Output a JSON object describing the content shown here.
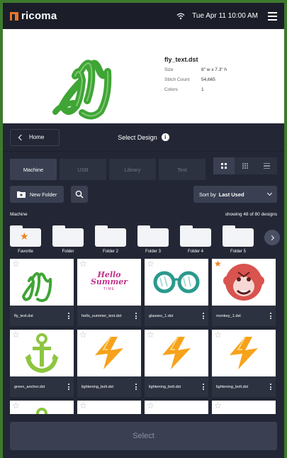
{
  "app": {
    "brand": "ricoma",
    "status_time": "Tue Apr 11  10:00 AM",
    "colors": {
      "accent": "#f0821e",
      "embroidery_green": "#3fa535",
      "bg": "#232735"
    }
  },
  "preview": {
    "filename": "fly_text.dst",
    "rows": [
      {
        "key": "Size",
        "value": "8\" w x 7.3\" h"
      },
      {
        "key": "Stitch Count",
        "value": "54,665"
      },
      {
        "key": "Colors",
        "value": "1"
      }
    ]
  },
  "header": {
    "back_label": "Home",
    "title": "Select Design"
  },
  "tabs": [
    {
      "label": "Machine",
      "active": true
    },
    {
      "label": "USB",
      "active": false
    },
    {
      "label": "Library",
      "active": false
    },
    {
      "label": "Text",
      "active": false
    }
  ],
  "actions": {
    "new_folder": "New Folder",
    "sort_prefix": "Sort by",
    "sort_value": "Last Used"
  },
  "meta": {
    "location": "Machine",
    "count": "showing 48 of 80 designs"
  },
  "folders": [
    {
      "label": "Favorite",
      "star": true
    },
    {
      "label": "Folder"
    },
    {
      "label": "Folder 2"
    },
    {
      "label": "Folder 3"
    },
    {
      "label": "Folder 4"
    },
    {
      "label": "Folder 5"
    }
  ],
  "designs": [
    {
      "name": "fly_text.dst",
      "fav": false,
      "art": "fly"
    },
    {
      "name": "hello_summer_text.dst",
      "fav": false,
      "art": "summer",
      "art_text_1": "Hello",
      "art_text_2": "Summer",
      "art_text_3": "TIME"
    },
    {
      "name": "glasses_1.dst",
      "fav": false,
      "art": "glasses"
    },
    {
      "name": "monkey_1.dst",
      "fav": true,
      "art": "monkey"
    },
    {
      "name": "green_anchor.dst",
      "fav": false,
      "art": "anchor"
    },
    {
      "name": "lightening_bolt.dst",
      "fav": false,
      "art": "bolt"
    },
    {
      "name": "lightening_bolt.dst",
      "fav": false,
      "art": "bolt"
    },
    {
      "name": "lightening_bolt.dst",
      "fav": false,
      "art": "bolt"
    }
  ],
  "partial_designs": [
    {
      "fav": false,
      "art": "anchor-partial"
    },
    {
      "fav": false,
      "art": "blank"
    },
    {
      "fav": false,
      "art": "blank"
    },
    {
      "fav": false,
      "art": "blank"
    }
  ],
  "select_label": "Select"
}
